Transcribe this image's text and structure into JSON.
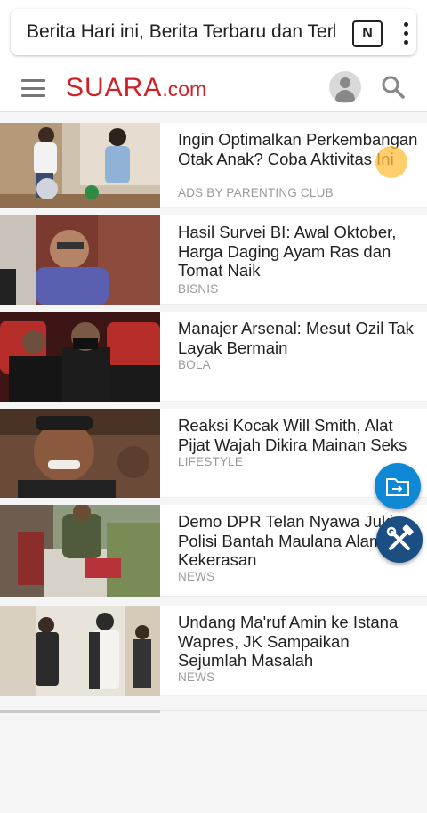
{
  "browser": {
    "url_text": "Berita Hari ini, Berita Terbaru dan Terkini",
    "tab_badge": "N"
  },
  "site": {
    "logo_main": "SUARA",
    "logo_suffix": ".com"
  },
  "articles": [
    {
      "title": "Ingin Optimalkan Perkembangan Otak Anak? Coba Aktivitas Ini",
      "category": "ADS BY PARENTING CLUB"
    },
    {
      "title": "Hasil Survei BI: Awal Oktober, Harga Daging Ayam Ras dan Tomat Naik",
      "category": "BISNIS"
    },
    {
      "title": "Manajer Arsenal: Mesut Ozil Tak Layak Bermain",
      "category": "BOLA"
    },
    {
      "title": "Reaksi Kocak Will Smith, Alat Pijat Wajah Dikira Mainan Seks",
      "category": "LIFESTYLE"
    },
    {
      "title": "Demo DPR Telan Nyawa Jukir, Polisi Bantah Maulana Alami Kekerasan",
      "category": "NEWS"
    },
    {
      "title": "Undang Ma'ruf Amin ke Istana Wapres, JK Sampaikan Sejumlah Masalah",
      "category": "NEWS"
    }
  ],
  "colors": {
    "brand": "#d11f25",
    "fab_folder": "#0f88d6",
    "fab_tools": "#1b4f84"
  }
}
